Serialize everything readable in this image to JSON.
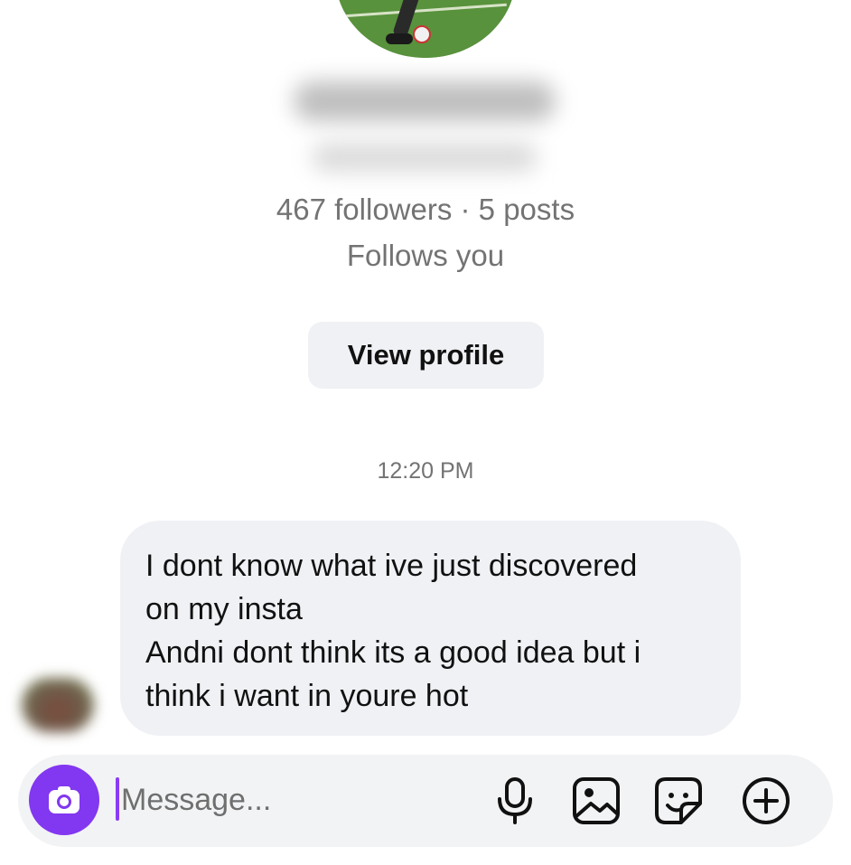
{
  "profile": {
    "stats": "467 followers · 5 posts",
    "follows_status": "Follows you",
    "view_profile_label": "View profile"
  },
  "thread": {
    "timestamp": "12:20 PM",
    "messages": [
      {
        "lines": [
          "I dont know what ive just discovered",
          "on my insta",
          "Andni dont think its a good idea but i",
          "think i want in youre hot"
        ]
      }
    ]
  },
  "composer": {
    "placeholder": "Message...",
    "icons": [
      "camera-icon",
      "microphone-icon",
      "gallery-icon",
      "sticker-icon",
      "add-icon"
    ],
    "accent_color": "#8237f0"
  }
}
